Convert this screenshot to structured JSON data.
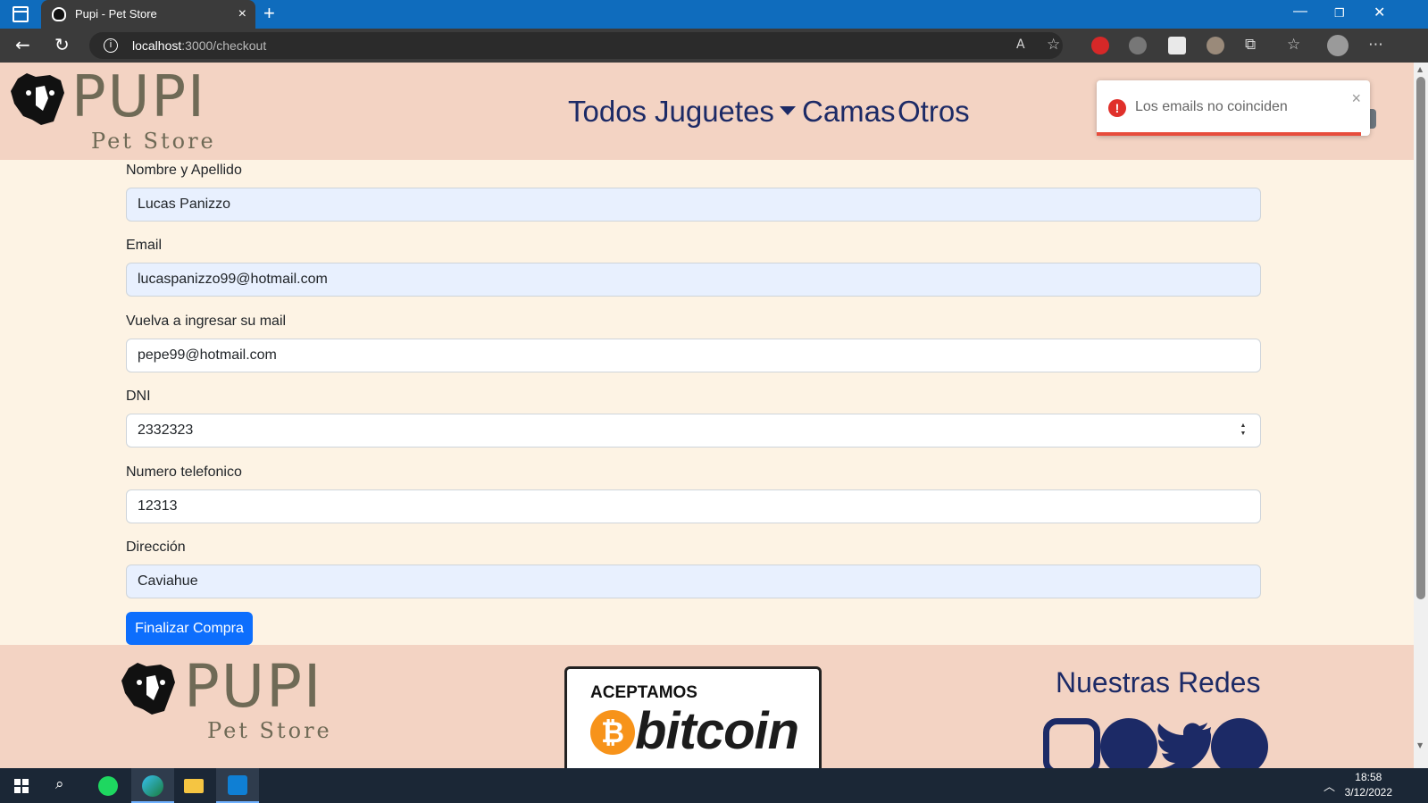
{
  "browser": {
    "tab_title": "Pupi - Pet Store",
    "url_host": "localhost",
    "url_path": ":3000/checkout",
    "new_tab": "+",
    "win_minimize": "—",
    "win_restore": "❐",
    "win_close": "✕"
  },
  "header": {
    "brand": "PUPI",
    "brand_sub": "Pet Store",
    "nav": [
      {
        "label": "Todos"
      },
      {
        "label": "Juguetes"
      },
      {
        "label": "Camas"
      },
      {
        "label": "Otros"
      }
    ]
  },
  "toast": {
    "message": "Los emails no coinciden",
    "icon": "!",
    "close": "×",
    "accent": "#e74c3c"
  },
  "form": {
    "fields": [
      {
        "label": "Nombre y Apellido",
        "value": "Lucas Panizzo",
        "autofill": true
      },
      {
        "label": "Email",
        "value": "lucaspanizzo99@hotmail.com",
        "autofill": true
      },
      {
        "label": "Vuelva a ingresar su mail",
        "value": "pepe99@hotmail.com",
        "autofill": false
      },
      {
        "label": "DNI",
        "value": "2332323",
        "autofill": false
      },
      {
        "label": "Numero telefonico",
        "value": "12313",
        "autofill": false
      },
      {
        "label": "Dirección",
        "value": "Caviahue",
        "autofill": true
      }
    ],
    "submit_label": "Finalizar Compra",
    "submit_color": "#0d6efd"
  },
  "footer": {
    "brand": "PUPI",
    "brand_sub": "Pet Store",
    "bitcoin_top": "ACEPTAMOS",
    "bitcoin_symbol": "₿",
    "bitcoin_word": "bitcoin",
    "social_title": "Nuestras Redes",
    "social_icons": [
      "instagram-icon",
      "facebook-icon",
      "twitter-icon",
      "telegram-icon"
    ]
  },
  "taskbar": {
    "time": "18:58",
    "date": "3/12/2022"
  }
}
